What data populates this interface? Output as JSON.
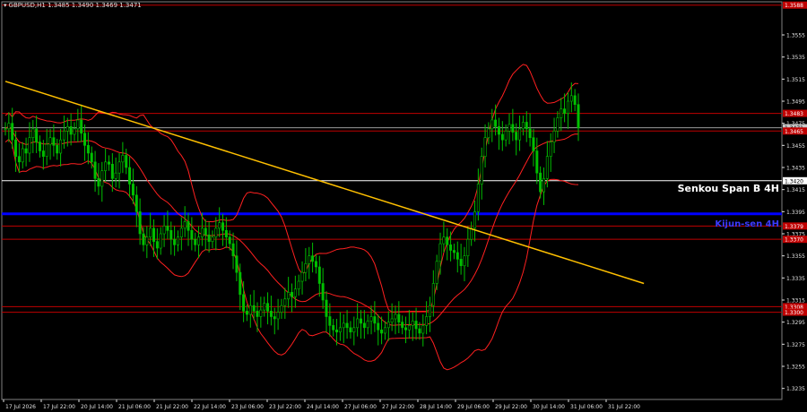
{
  "window": {
    "title": "GBPUSD,H1  1.3485 1.3490 1.3469 1.3471"
  },
  "colors": {
    "background": "#000000",
    "candle": "#00c000",
    "axis": "#e0e0e0",
    "red_level": "#c00000",
    "white_level": "#ffffff",
    "blue_level": "#0000ff",
    "trendline": "#ffc000",
    "bands": "#ff2020"
  },
  "chart_data": {
    "type": "candlestick",
    "symbol": "GBPUSD",
    "timeframe": "H1",
    "last_ohlc": {
      "open": 1.3485,
      "high": 1.349,
      "low": 1.3469,
      "close": 1.3471
    },
    "ylim": [
      1.3225,
      1.3585
    ],
    "y_ticks": [
      "1.3555",
      "1.3535",
      "1.3515",
      "1.3495",
      "1.3475",
      "1.3455",
      "1.3435",
      "1.3415",
      "1.3395",
      "1.3375",
      "1.3355",
      "1.3335",
      "1.3315",
      "1.3295",
      "1.3275",
      "1.3255",
      "1.3235"
    ],
    "x_ticks": [
      "17 Jul 2026",
      "17 Jul 22:00",
      "20 Jul 14:00",
      "21 Jul 06:00",
      "21 Jul 22:00",
      "22 Jul 14:00",
      "23 Jul 06:00",
      "23 Jul 22:00",
      "24 Jul 14:00",
      "27 Jul 06:00",
      "27 Jul 22:00",
      "28 Jul 14:00",
      "29 Jul 06:00",
      "29 Jul 22:00",
      "30 Jul 14:00",
      "31 Jul 06:00",
      "31 Jul 22:00"
    ],
    "horizontal_levels": [
      {
        "price": 1.3582,
        "label": "1.3588",
        "color": "red"
      },
      {
        "price": 1.3484,
        "label": "1.3483",
        "color": "red"
      },
      {
        "price": 1.3471,
        "label": "1.3471",
        "color": "gray"
      },
      {
        "price": 1.3468,
        "label": "1.3465",
        "color": "red"
      },
      {
        "price": 1.3423,
        "label": "1.3420",
        "color": "white",
        "name": "Senkou Span B 4H"
      },
      {
        "price": 1.3393,
        "label": "",
        "color": "blue",
        "name": "Kijun-sen 4H"
      },
      {
        "price": 1.3382,
        "label": "1.3379",
        "color": "red"
      },
      {
        "price": 1.337,
        "label": "1.3370",
        "color": "red"
      },
      {
        "price": 1.3309,
        "label": "1.3308",
        "color": "red"
      },
      {
        "price": 1.3304,
        "label": "1.3300",
        "color": "red"
      }
    ],
    "trendline": {
      "start": {
        "bar": 0,
        "price": 1.3513
      },
      "end": {
        "bar": 185,
        "price": 1.333
      }
    },
    "series": [
      {
        "values": [
          1.347,
          1.3475,
          1.346,
          1.3445,
          1.344,
          1.3452,
          1.3448,
          1.3462,
          1.347,
          1.3458,
          1.345,
          1.3445,
          1.3456,
          1.3462,
          1.3455,
          1.3448,
          1.346,
          1.3468,
          1.3472,
          1.3465,
          1.347,
          1.3478,
          1.3466,
          1.3455,
          1.3448,
          1.344,
          1.3425,
          1.3418,
          1.3432,
          1.344,
          1.3438,
          1.3425,
          1.343,
          1.344,
          1.3446,
          1.3435,
          1.342,
          1.341,
          1.3395,
          1.3375,
          1.3365,
          1.3372,
          1.338,
          1.3368,
          1.3362,
          1.3375,
          1.3382,
          1.3378,
          1.337,
          1.3365,
          1.3372,
          1.338,
          1.3386,
          1.3378,
          1.337,
          1.3365,
          1.3372,
          1.338,
          1.3374,
          1.3368,
          1.3372,
          1.338,
          1.3385,
          1.3378,
          1.3372,
          1.3366,
          1.3355,
          1.334,
          1.332,
          1.3305,
          1.3302,
          1.331,
          1.3305,
          1.33,
          1.3306,
          1.3312,
          1.3305,
          1.33,
          1.3298,
          1.3304,
          1.331,
          1.3316,
          1.3322,
          1.3318,
          1.3325,
          1.3332,
          1.334,
          1.3348,
          1.3355,
          1.335,
          1.3345,
          1.333,
          1.3315,
          1.33,
          1.3292,
          1.3288,
          1.3286,
          1.329,
          1.3294,
          1.329,
          1.3286,
          1.329,
          1.3298,
          1.3294,
          1.329,
          1.3296,
          1.33,
          1.3294,
          1.3288,
          1.3285,
          1.329,
          1.3295,
          1.3298,
          1.3302,
          1.3295,
          1.329,
          1.3288,
          1.3292,
          1.3296,
          1.3289,
          1.3285,
          1.3292,
          1.33,
          1.331,
          1.333,
          1.335,
          1.3366,
          1.3372,
          1.3365,
          1.336,
          1.3358,
          1.3352,
          1.3346,
          1.3355,
          1.337,
          1.338,
          1.3395,
          1.342,
          1.3445,
          1.3462,
          1.347,
          1.3478,
          1.3472,
          1.3465,
          1.346,
          1.3468,
          1.3474,
          1.3467,
          1.346,
          1.347,
          1.3476,
          1.347,
          1.3462,
          1.345,
          1.343,
          1.3413,
          1.3425,
          1.3445,
          1.3458,
          1.3468,
          1.348,
          1.3488,
          1.3484,
          1.3495,
          1.35,
          1.3492,
          1.3471
        ]
      }
    ]
  },
  "labels": {
    "senkou": "Senkou Span B 4H",
    "kijun": "Kijun-sen 4H"
  }
}
